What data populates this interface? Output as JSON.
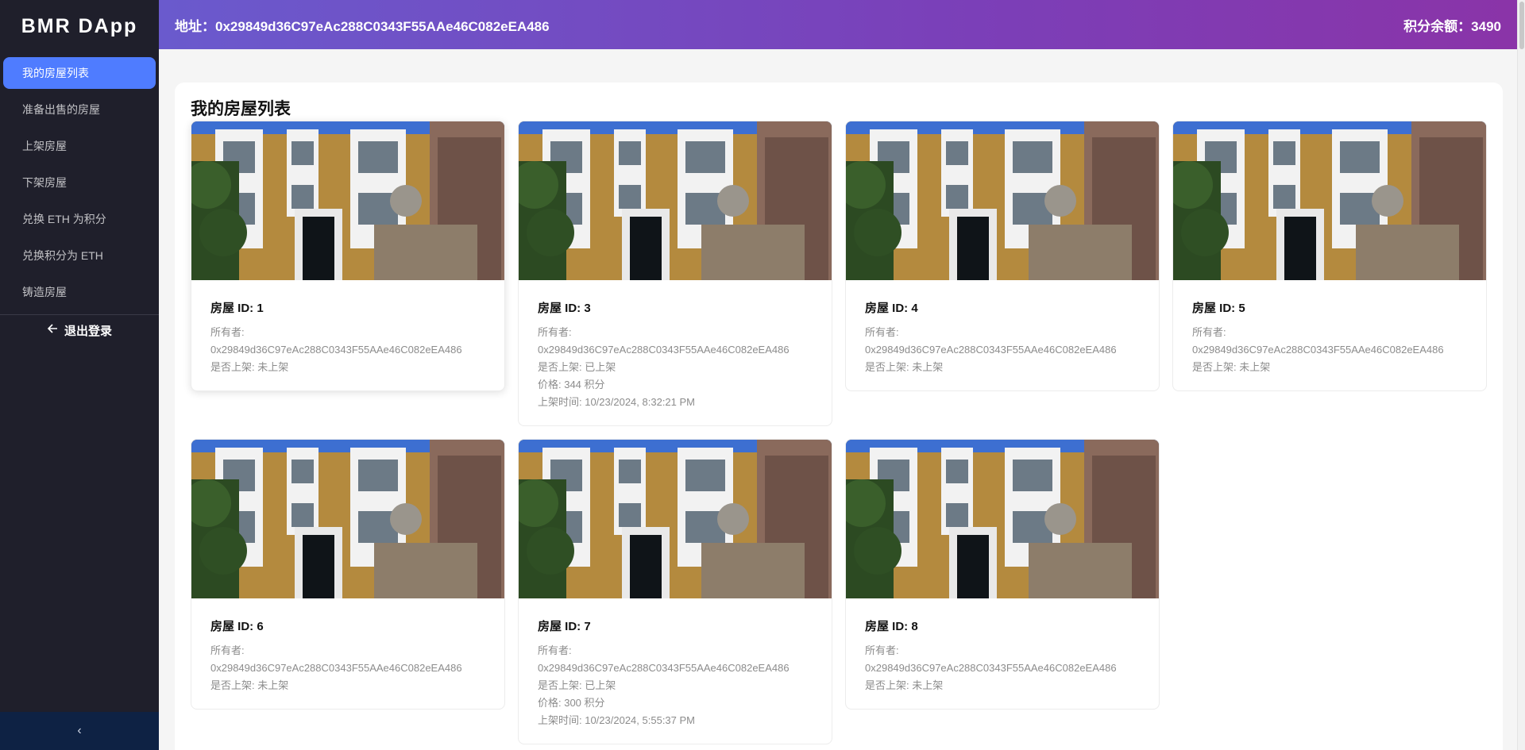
{
  "app": {
    "title": "BMR DApp"
  },
  "sidebar": {
    "items": [
      {
        "label": "我的房屋列表",
        "active": true
      },
      {
        "label": "准备出售的房屋",
        "active": false
      },
      {
        "label": "上架房屋",
        "active": false
      },
      {
        "label": "下架房屋",
        "active": false
      },
      {
        "label": "兑换 ETH 为积分",
        "active": false
      },
      {
        "label": "兑换积分为 ETH",
        "active": false
      },
      {
        "label": "铸造房屋",
        "active": false
      }
    ],
    "logout_label": "退出登录",
    "collapse_icon": "‹"
  },
  "header": {
    "address_text": "地址：0x29849d36C97eAc288C0343F55AAe46C082eEA486",
    "balance_text": "积分余额：3490"
  },
  "page": {
    "title": "我的房屋列表"
  },
  "houses": [
    {
      "title": "房屋 ID: 1",
      "owner_label": "所有者:",
      "owner": "0x29849d36C97eAc288C0343F55AAe46C082eEA486",
      "listed": "是否上架: 未上架"
    },
    {
      "title": "房屋 ID: 3",
      "owner_label": "所有者:",
      "owner": "0x29849d36C97eAc288C0343F55AAe46C082eEA486",
      "listed": "是否上架: 已上架",
      "price": "价格: 344 积分",
      "time": "上架时间: 10/23/2024, 8:32:21 PM"
    },
    {
      "title": "房屋 ID: 4",
      "owner_label": "所有者:",
      "owner": "0x29849d36C97eAc288C0343F55AAe46C082eEA486",
      "listed": "是否上架: 未上架"
    },
    {
      "title": "房屋 ID: 5",
      "owner_label": "所有者:",
      "owner": "0x29849d36C97eAc288C0343F55AAe46C082eEA486",
      "listed": "是否上架: 未上架"
    },
    {
      "title": "房屋 ID: 6",
      "owner_label": "所有者:",
      "owner": "0x29849d36C97eAc288C0343F55AAe46C082eEA486",
      "listed": "是否上架: 未上架"
    },
    {
      "title": "房屋 ID: 7",
      "owner_label": "所有者:",
      "owner": "0x29849d36C97eAc288C0343F55AAe46C082eEA486",
      "listed": "是否上架: 已上架",
      "price": "价格: 300 积分",
      "time": "上架时间: 10/23/2024, 5:55:37 PM"
    },
    {
      "title": "房屋 ID: 8",
      "owner_label": "所有者:",
      "owner": "0x29849d36C97eAc288C0343F55AAe46C082eEA486",
      "listed": "是否上架: 未上架"
    }
  ],
  "colors": {
    "sidebar_bg": "#1f1f2b",
    "active_item": "#4f7cff",
    "header_start": "#6a5acd",
    "header_end": "#8a34a8"
  }
}
